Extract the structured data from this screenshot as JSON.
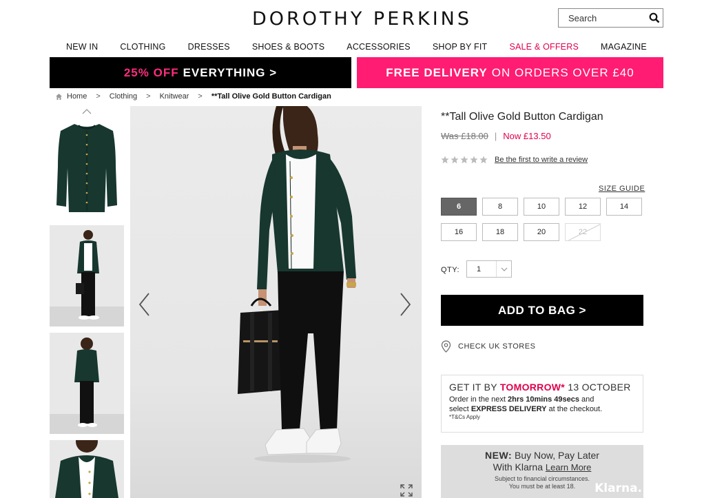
{
  "header": {
    "logo": "DOROTHY PERKINS",
    "search_placeholder": "Search",
    "search_icon": "search-icon"
  },
  "nav": {
    "items": [
      "NEW IN",
      "CLOTHING",
      "DRESSES",
      "SHOES & BOOTS",
      "ACCESSORIES",
      "SHOP BY FIT",
      "SALE & OFFERS",
      "MAGAZINE"
    ],
    "sale_color": "#e0004d"
  },
  "promos": {
    "left_highlight": "25% OFF",
    "left_text": "EVERYTHING >",
    "right_highlight": "FREE DELIVERY",
    "right_text": "ON ORDERS OVER £40",
    "left_bg": "#000000",
    "right_bg": "#ff1c72"
  },
  "breadcrumb": {
    "items": [
      "Home",
      "Clothing",
      "Knitwear"
    ],
    "separator": ">",
    "current": "**Tall Olive Gold Button Cardigan"
  },
  "product": {
    "title": "**Tall Olive Gold Button Cardigan",
    "was_price": "Was £18.00",
    "price_separator": "|",
    "now_price": "Now £13.50",
    "rating_stars": 0,
    "review_link": "Be the first to write a review",
    "size_guide": "SIZE GUIDE",
    "sizes": [
      "6",
      "8",
      "10",
      "12",
      "14",
      "16",
      "18",
      "20",
      "22"
    ],
    "selected_size": "6",
    "unavailable_sizes": [
      "22"
    ],
    "qty_label": "QTY:",
    "qty_value": "1",
    "add_to_bag": "ADD TO BAG >",
    "check_stores": "CHECK UK STORES"
  },
  "delivery": {
    "get_it_by": "GET IT BY",
    "tomorrow": "TOMORROW*",
    "date": "13 OCTOBER",
    "line1_pre": "Order in the next",
    "countdown": "2hrs 10mins 49secs",
    "line1_post": "and",
    "line2_pre": "select",
    "express": "EXPRESS DELIVERY",
    "line2_post": "at the checkout.",
    "tc": "*T&Cs Apply"
  },
  "klarna": {
    "new_label": "NEW:",
    "line1": "Buy Now, Pay Later",
    "line2_pre": "With Klarna",
    "learn_more": "Learn More",
    "note1": "Subject to financial circumstances.",
    "note2": "You must be at least 18.",
    "brand": "Klarna."
  },
  "colors": {
    "accent_pink": "#e0004d",
    "promo_pink": "#ff1c72",
    "cardigan_green": "#17372f"
  }
}
